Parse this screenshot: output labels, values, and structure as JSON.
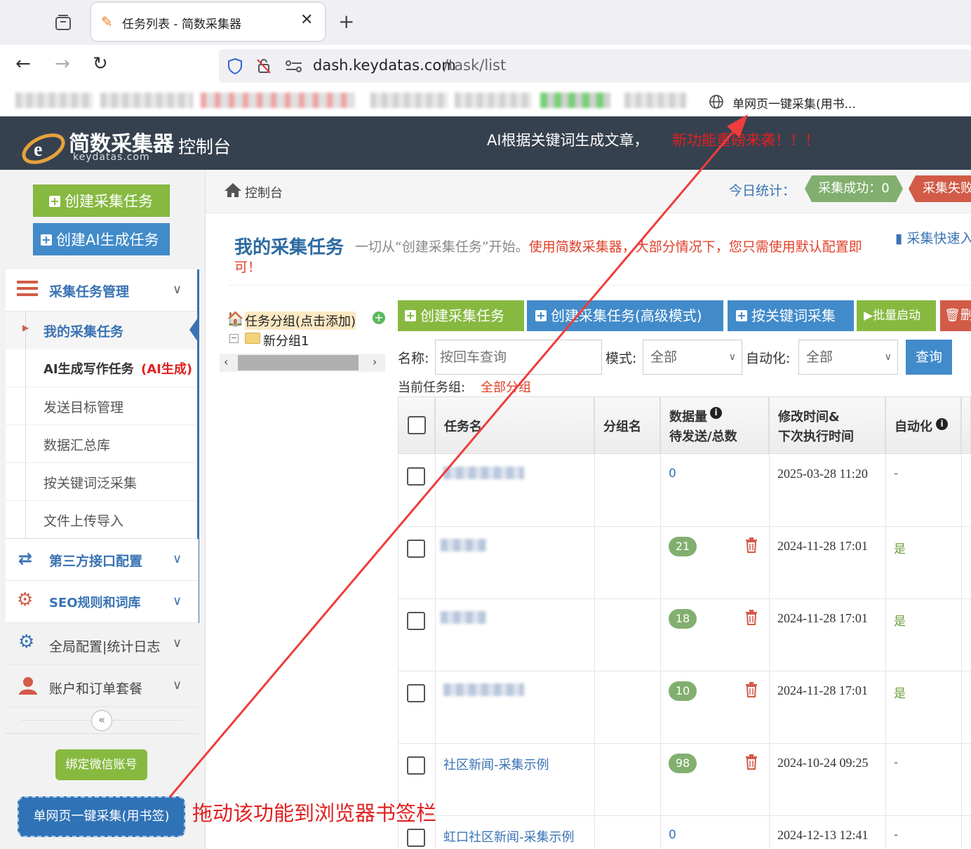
{
  "browser": {
    "tab_title": "任务列表 - 简数采集器",
    "url_host": "dash.keydatas.com",
    "url_path": "/task/list",
    "bookmark_visible": "单网页一键采集(用书..."
  },
  "header": {
    "logo_text": "简数采集器",
    "logo_sub": "keydatas.com",
    "title": "控制台",
    "notice_white": "AI根据关键词生成文章，",
    "notice_red": "新功能重磅来袭！！！"
  },
  "sidebar": {
    "create_task": "创建采集任务",
    "create_ai_task": "创建AI生成任务",
    "group_title": "采集任务管理",
    "items": [
      "我的采集任务",
      "AI生成写作任务",
      "发送目标管理",
      "数据汇总库",
      "按关键词泛采集",
      "文件上传导入"
    ],
    "ai_tag": "(AI生成)",
    "third_party": "第三方接口配置",
    "seo": "SEO规则和词库",
    "global": "全局配置|统计日志",
    "account": "账户和订单套餐",
    "bind_wechat": "绑定微信账号",
    "bookmarklet": "单网页一键采集(用书签)"
  },
  "breadcrumb": {
    "home": "控制台",
    "stats_label": "今日统计：",
    "success": "采集成功：0",
    "fail": "采集失败"
  },
  "page": {
    "title": "我的采集任务",
    "desc_gray": "一切从“创建采集任务”开始。",
    "desc_red": "使用简数采集器，大部分情况下，您只需使用默认配置即可！",
    "tutorial": "采集快速入门视频教程",
    "tree_root": "任务分组(点击添加)",
    "tree_child": "新分组1"
  },
  "toolbar": {
    "create": "创建采集任务",
    "create_adv": "创建采集任务(高级模式)",
    "keyword": "按关键词采集",
    "batch_start": "批量启动",
    "delete": "删"
  },
  "filters": {
    "name_label": "名称:",
    "name_placeholder": "按回车查询",
    "mode_label": "模式:",
    "mode_value": "全部",
    "auto_label": "自动化:",
    "auto_value": "全部",
    "query": "查询",
    "group_label": "当前任务组:",
    "group_value": "全部分组"
  },
  "table": {
    "headers": {
      "name": "任务名",
      "group": "分组名",
      "data_1": "数据量",
      "data_2": "待发送/总数",
      "time_1": "修改时间&",
      "time_2": "下次执行时间",
      "auto": "自动化"
    },
    "rows": [
      {
        "name": "",
        "data": "0",
        "time": "2025-03-28 11:20",
        "auto": "-"
      },
      {
        "name": "",
        "data": "21",
        "time": "2024-11-28 17:01",
        "auto": "是"
      },
      {
        "name": "",
        "data": "18",
        "time": "2024-11-28 17:01",
        "auto": "是"
      },
      {
        "name": "",
        "data": "10",
        "time": "2024-11-28 17:01",
        "auto": "是"
      },
      {
        "name": "社区新闻-采集示例",
        "data": "98",
        "time": "2024-10-24 09:25",
        "auto": "-"
      },
      {
        "name": "虹口社区新闻-采集示例",
        "data": "0",
        "time": "2024-12-13 12:41",
        "auto": "-"
      }
    ]
  },
  "annotation": "拖动该功能到浏览器书签栏"
}
